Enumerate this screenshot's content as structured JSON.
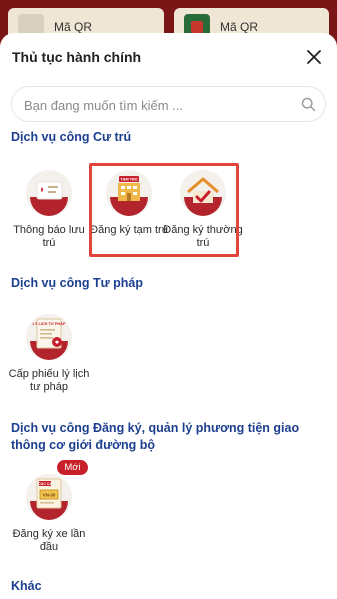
{
  "background": {
    "cards": [
      {
        "label": "Mã QR"
      },
      {
        "label": "Mã QR"
      }
    ]
  },
  "sheet": {
    "title": "Thủ tục hành chính",
    "search_placeholder": "Bạn đang muốn tìm kiếm ..."
  },
  "sections": [
    {
      "title": "Dịch vụ công Cư trú",
      "items": [
        {
          "label": "Thông báo lưu trú",
          "icon": "notice-icon"
        },
        {
          "label": "Đăng ký tạm trú",
          "icon": "temporary-residence-icon",
          "icon_tag": "TẠM TRÚ"
        },
        {
          "label": "Đăng ký thường trú",
          "icon": "permanent-residence-icon"
        }
      ]
    },
    {
      "title": "Dịch vụ công Tư pháp",
      "items": [
        {
          "label": "Cấp phiếu lý lịch tư pháp",
          "icon": "criminal-record-icon",
          "icon_tag": "LÝ LỊCH TƯ PHÁP"
        }
      ]
    },
    {
      "title": "Dịch vụ công Đăng ký, quản lý phương tiện giao thông cơ giới đường bộ",
      "items": [
        {
          "label": "Đăng ký xe lần đầu",
          "icon": "vehicle-registration-icon",
          "badge": "Mới",
          "icon_tag": "CỤC CA",
          "plate": "VN-30"
        }
      ]
    },
    {
      "title": "Khác",
      "items": []
    }
  ],
  "colors": {
    "accent_red": "#c8202a",
    "section_blue": "#1d3f8f",
    "highlight": "#e0443a"
  }
}
